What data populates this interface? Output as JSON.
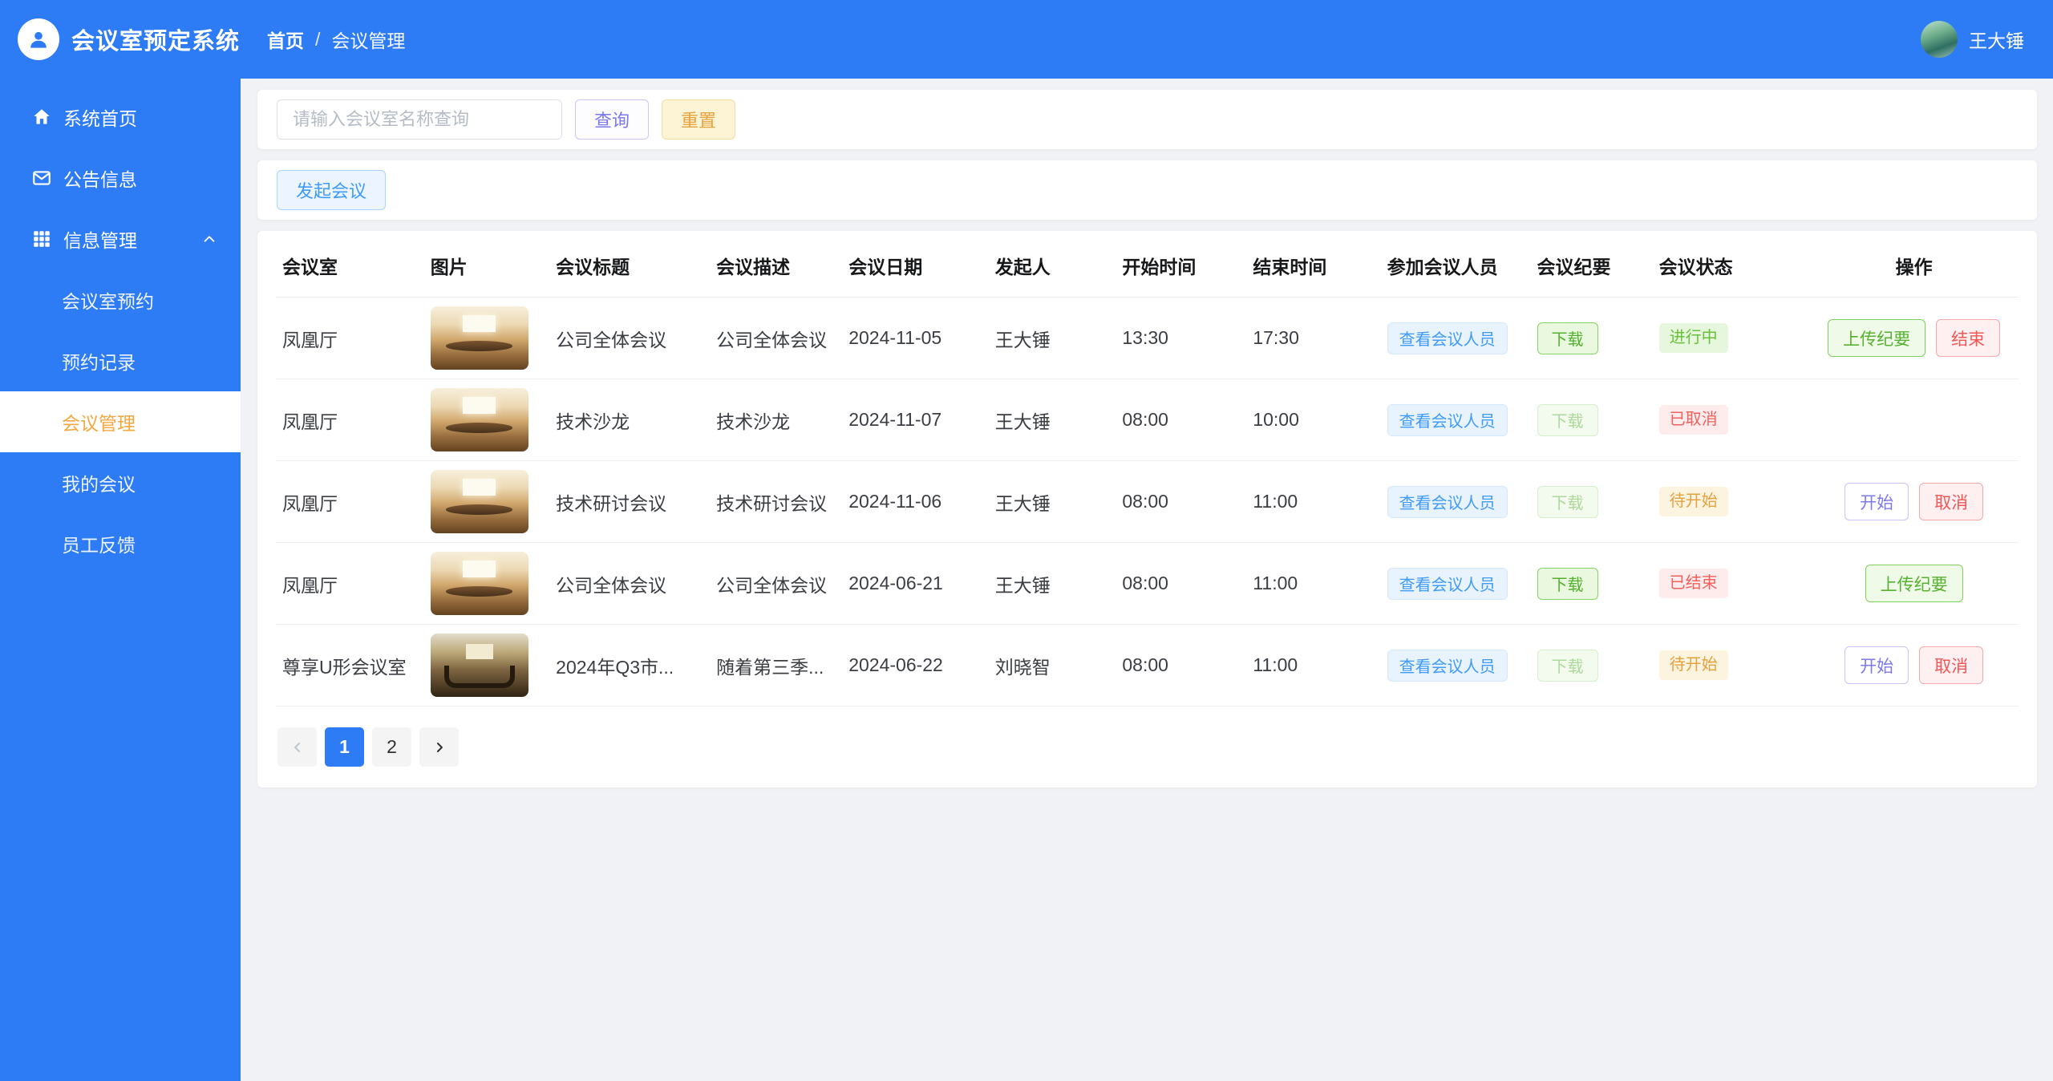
{
  "header": {
    "app_title": "会议室预定系统",
    "breadcrumb": {
      "home": "首页",
      "separator": "/",
      "current": "会议管理"
    },
    "user_name": "王大锤"
  },
  "sidebar": {
    "items": [
      {
        "label": "系统首页",
        "icon": "home-icon"
      },
      {
        "label": "公告信息",
        "icon": "mail-icon"
      },
      {
        "label": "信息管理",
        "icon": "grid-icon",
        "expanded": true,
        "children": [
          {
            "label": "会议室预约",
            "active": false
          },
          {
            "label": "预约记录",
            "active": false
          },
          {
            "label": "会议管理",
            "active": true
          },
          {
            "label": "我的会议",
            "active": false
          },
          {
            "label": "员工反馈",
            "active": false
          }
        ]
      }
    ]
  },
  "toolbar": {
    "search_placeholder": "请输入会议室名称查询",
    "search_label": "查询",
    "reset_label": "重置",
    "create_meeting_label": "发起会议"
  },
  "table": {
    "columns": [
      "会议室",
      "图片",
      "会议标题",
      "会议描述",
      "会议日期",
      "发起人",
      "开始时间",
      "结束时间",
      "参加会议人员",
      "会议纪要",
      "会议状态",
      "操作"
    ],
    "view_participants_label": "查看会议人员",
    "download_label": "下载",
    "rows": [
      {
        "room": "凤凰厅",
        "photo": "warm",
        "title": "公司全体会议",
        "description": "公司全体会议",
        "date": "2024-11-05",
        "initiator": "王大锤",
        "start_time": "13:30",
        "end_time": "17:30",
        "download_enabled": true,
        "status": {
          "label": "进行中",
          "type": "success"
        },
        "operations": [
          {
            "label": "上传纪要",
            "type": "success"
          },
          {
            "label": "结束",
            "type": "danger"
          }
        ]
      },
      {
        "room": "凤凰厅",
        "photo": "warm",
        "title": "技术沙龙",
        "description": "技术沙龙",
        "date": "2024-11-07",
        "initiator": "王大锤",
        "start_time": "08:00",
        "end_time": "10:00",
        "download_enabled": false,
        "status": {
          "label": "已取消",
          "type": "danger"
        },
        "operations": []
      },
      {
        "room": "凤凰厅",
        "photo": "warm",
        "title": "技术研讨会议",
        "description": "技术研讨会议",
        "date": "2024-11-06",
        "initiator": "王大锤",
        "start_time": "08:00",
        "end_time": "11:00",
        "download_enabled": false,
        "status": {
          "label": "待开始",
          "type": "warning"
        },
        "operations": [
          {
            "label": "开始",
            "type": "primary"
          },
          {
            "label": "取消",
            "type": "danger"
          }
        ]
      },
      {
        "room": "凤凰厅",
        "photo": "warm",
        "title": "公司全体会议",
        "description": "公司全体会议",
        "date": "2024-06-21",
        "initiator": "王大锤",
        "start_time": "08:00",
        "end_time": "11:00",
        "download_enabled": true,
        "status": {
          "label": "已结束",
          "type": "danger"
        },
        "operations": [
          {
            "label": "上传纪要",
            "type": "success"
          }
        ]
      },
      {
        "room": "尊享U形会议室",
        "photo": "dark",
        "title": "2024年Q3市...",
        "description": "随着第三季...",
        "date": "2024-06-22",
        "initiator": "刘晓智",
        "start_time": "08:00",
        "end_time": "11:00",
        "download_enabled": false,
        "status": {
          "label": "待开始",
          "type": "warning"
        },
        "operations": [
          {
            "label": "开始",
            "type": "primary"
          },
          {
            "label": "取消",
            "type": "danger"
          }
        ]
      }
    ]
  },
  "pagination": {
    "current": "1",
    "pages": [
      "1",
      "2"
    ]
  },
  "colors": {
    "primary_blue": "#2e7bf6",
    "active_menu_orange": "#f5a742",
    "success_green": "#67c23a",
    "danger_red": "#f56c6c",
    "warning_orange": "#e6a23c",
    "link_blue": "#3f9bfb",
    "purple_action": "#7b78f2"
  }
}
